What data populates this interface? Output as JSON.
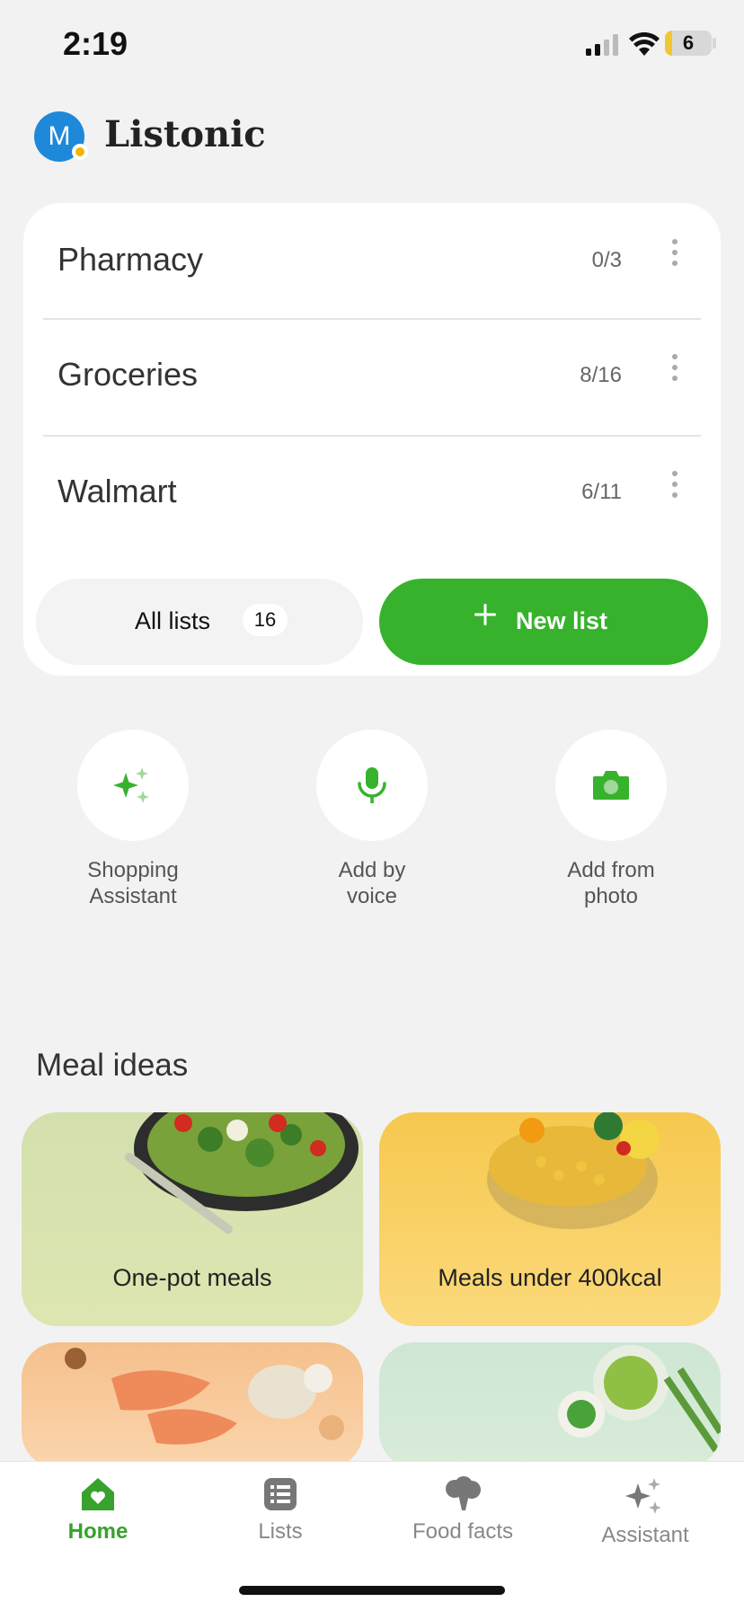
{
  "status": {
    "time": "2:19",
    "battery": "6"
  },
  "header": {
    "avatar_letter": "M",
    "title": "Listonic"
  },
  "lists": [
    {
      "name": "Pharmacy",
      "count": "0/3"
    },
    {
      "name": "Groceries",
      "count": "8/16"
    },
    {
      "name": "Walmart",
      "count": "6/11"
    }
  ],
  "buttons": {
    "all_lists": "All lists",
    "all_lists_count": "16",
    "new_list": "New list"
  },
  "actions": [
    {
      "line1": "Shopping",
      "line2": "Assistant",
      "icon": "sparkle-icon"
    },
    {
      "line1": "Add by",
      "line2": "voice",
      "icon": "microphone-icon"
    },
    {
      "line1": "Add from",
      "line2": "photo",
      "icon": "camera-icon"
    }
  ],
  "meal_ideas": {
    "title": "Meal ideas",
    "cards": [
      {
        "label": "One-pot meals"
      },
      {
        "label": "Meals under 400kcal"
      },
      {
        "label": ""
      },
      {
        "label": ""
      }
    ]
  },
  "tabbar": [
    {
      "label": "Home",
      "icon": "home-heart-icon"
    },
    {
      "label": "Lists",
      "icon": "list-icon"
    },
    {
      "label": "Food facts",
      "icon": "broccoli-icon"
    },
    {
      "label": "Assistant",
      "icon": "sparkle-icon"
    }
  ],
  "colors": {
    "accent": "#37b22d",
    "avatar": "#1e88d9",
    "background": "#f2f2f2"
  }
}
